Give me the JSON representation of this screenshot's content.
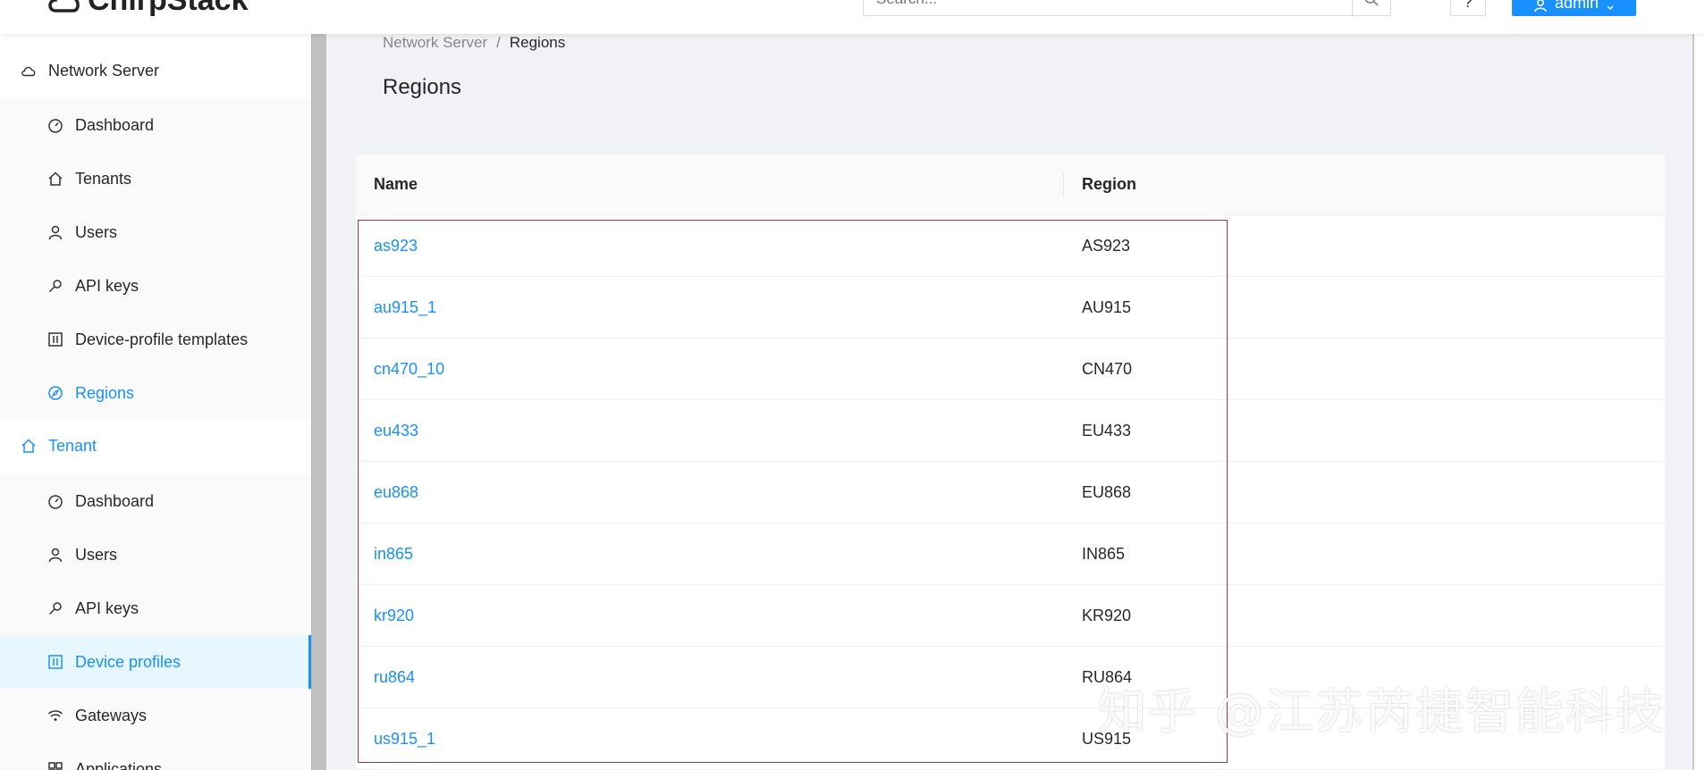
{
  "header": {
    "logo_text": "ChirpStack",
    "search_placeholder": "Search...",
    "help_label": "?",
    "user_label": "admin"
  },
  "sidebar": {
    "network_server": {
      "title": "Network Server",
      "items": [
        {
          "label": "Dashboard",
          "icon": "dashboard-icon"
        },
        {
          "label": "Tenants",
          "icon": "home-icon"
        },
        {
          "label": "Users",
          "icon": "user-icon"
        },
        {
          "label": "API keys",
          "icon": "key-icon"
        },
        {
          "label": "Device-profile templates",
          "icon": "control-icon"
        },
        {
          "label": "Regions",
          "icon": "compass-icon"
        }
      ]
    },
    "tenant": {
      "title": "Tenant",
      "items": [
        {
          "label": "Dashboard",
          "icon": "dashboard-icon"
        },
        {
          "label": "Users",
          "icon": "user-icon"
        },
        {
          "label": "API keys",
          "icon": "key-icon"
        },
        {
          "label": "Device profiles",
          "icon": "control-icon"
        },
        {
          "label": "Gateways",
          "icon": "wifi-icon"
        },
        {
          "label": "Applications",
          "icon": "appstore-icon"
        }
      ]
    }
  },
  "breadcrumb": {
    "parent": "Network Server",
    "separator": "/",
    "current": "Regions"
  },
  "page_title": "Regions",
  "table": {
    "columns": [
      "Name",
      "Region"
    ],
    "rows": [
      {
        "name": "as923",
        "region": "AS923"
      },
      {
        "name": "au915_1",
        "region": "AU915"
      },
      {
        "name": "cn470_10",
        "region": "CN470"
      },
      {
        "name": "eu433",
        "region": "EU433"
      },
      {
        "name": "eu868",
        "region": "EU868"
      },
      {
        "name": "in865",
        "region": "IN865"
      },
      {
        "name": "kr920",
        "region": "KR920"
      },
      {
        "name": "ru864",
        "region": "RU864"
      },
      {
        "name": "us915_1",
        "region": "US915"
      }
    ]
  },
  "watermark": "知乎 @江苏芮捷智能科技",
  "colors": {
    "accent": "#1890ff",
    "highlight_box": "#a8324a",
    "background": "#f0f2f5"
  }
}
